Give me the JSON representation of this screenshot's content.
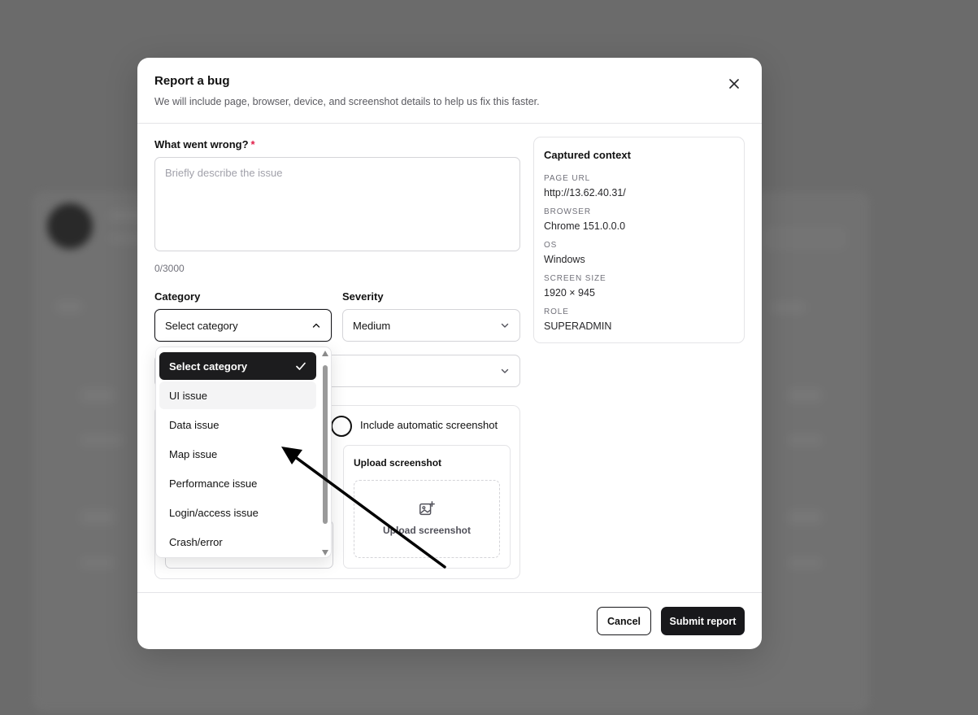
{
  "dialog": {
    "title": "Report a bug",
    "subtitle": "We will include page, browser, device, and screenshot details to help us fix this faster."
  },
  "form": {
    "description_label": "What went wrong?",
    "required_marker": "*",
    "description_placeholder": "Briefly describe the issue",
    "char_counter": "0/3000",
    "category_label": "Category",
    "category_value": "Select category",
    "severity_label": "Severity",
    "severity_value": "Medium",
    "auto_screenshot_label": "Include automatic screenshot",
    "upload_title": "Upload screenshot",
    "upload_button": "Upload screenshot"
  },
  "category_options": [
    {
      "label": "Select category",
      "selected": true
    },
    {
      "label": "UI issue",
      "hover": true
    },
    {
      "label": "Data issue"
    },
    {
      "label": "Map issue"
    },
    {
      "label": "Performance issue"
    },
    {
      "label": "Login/access issue"
    },
    {
      "label": "Crash/error"
    }
  ],
  "context": {
    "title": "Captured context",
    "items": [
      {
        "key": "PAGE URL",
        "value": "http://13.62.40.31/"
      },
      {
        "key": "BROWSER",
        "value": "Chrome 151.0.0.0"
      },
      {
        "key": "OS",
        "value": "Windows"
      },
      {
        "key": "SCREEN SIZE",
        "value": "1920 × 945"
      },
      {
        "key": "ROLE",
        "value": "SUPERADMIN"
      }
    ]
  },
  "footer": {
    "cancel_label": "Cancel",
    "submit_label": "Submit report"
  },
  "colors": {
    "overlay": "#6b6b6b",
    "primary": "#18181b",
    "required": "#e11d48",
    "border": "#e4e4e7"
  }
}
